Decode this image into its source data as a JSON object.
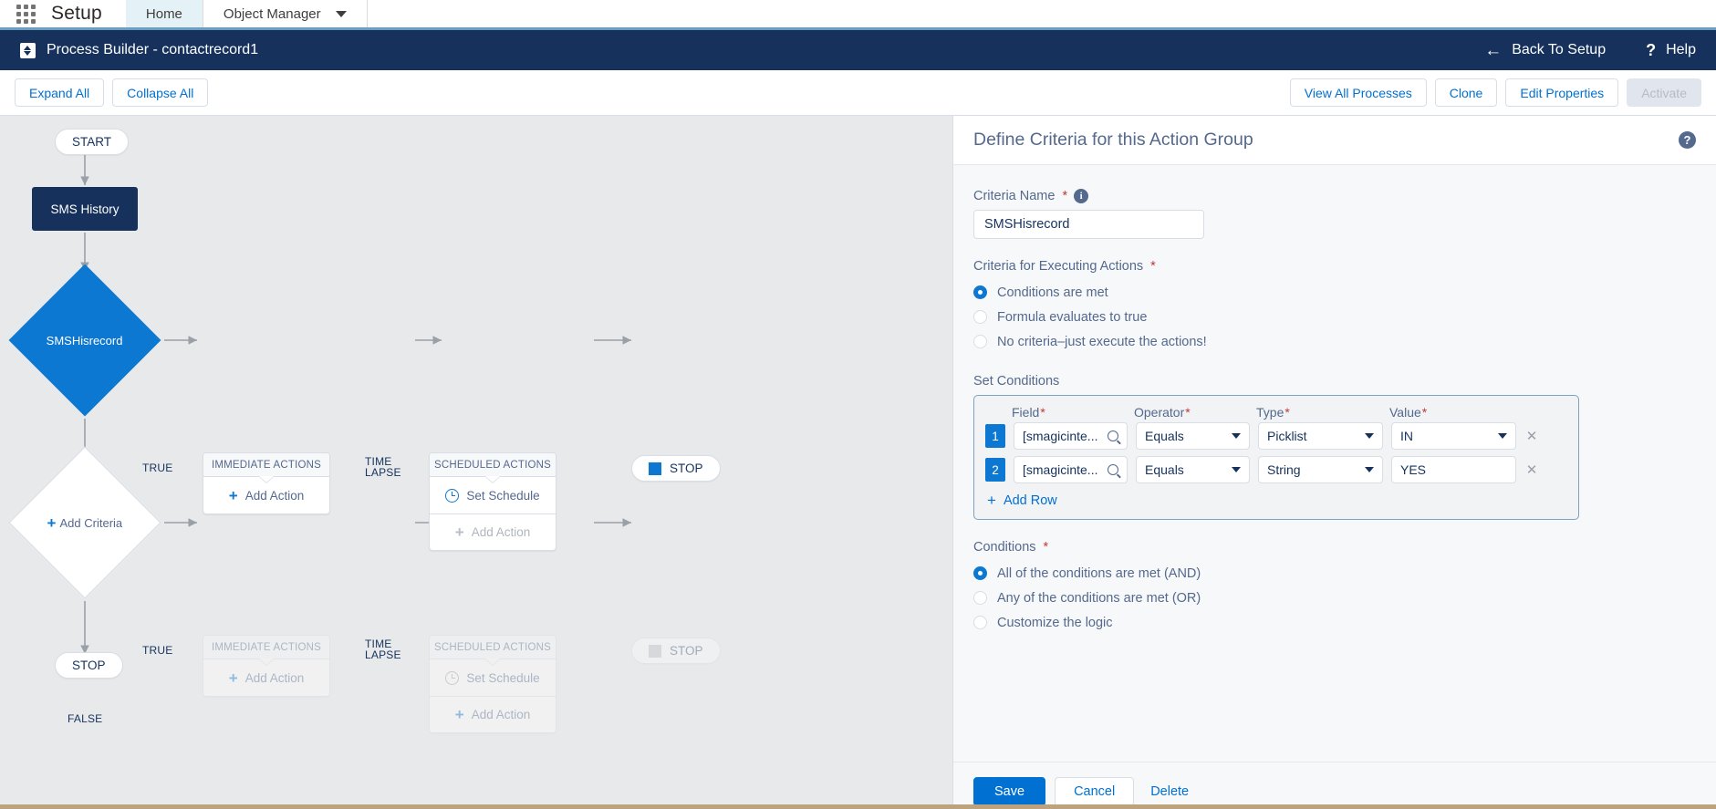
{
  "global_header": {
    "app_label": "Setup",
    "waffle_icon": "app-launcher-waffle-icon",
    "tabs": [
      {
        "label": "Home",
        "active": true,
        "has_chevron": false
      },
      {
        "label": "Object Manager",
        "active": false,
        "has_chevron": true
      }
    ]
  },
  "process_bar": {
    "icon": "process-builder-icon",
    "title": "Process Builder - contactrecord1",
    "back_label": "Back To Setup",
    "back_icon": "arrow-left-icon",
    "help_label": "Help",
    "help_icon": "question-mark-icon",
    "background": "#16325c"
  },
  "toolbar": {
    "expand_all": "Expand All",
    "collapse_all": "Collapse All",
    "view_all_processes": "View All Processes",
    "clone": "Clone",
    "edit_properties": "Edit Properties",
    "activate": "Activate",
    "activate_disabled": true
  },
  "canvas": {
    "start_label": "START",
    "object_node_label": "SMS History",
    "stop_label": "STOP",
    "criteria_1": {
      "label": "SMSHisrecord",
      "true_label": "TRUE",
      "false_label": "FALSE",
      "selected": true
    },
    "criteria_2": {
      "label": "Add Criteria",
      "plus_icon": "plus-icon",
      "true_label": "TRUE",
      "false_label": "FALSE",
      "selected": false
    },
    "immediate_actions_title": "IMMEDIATE ACTIONS",
    "scheduled_actions_title": "SCHEDULED ACTIONS",
    "time_lapse_line1": "TIME",
    "time_lapse_line2": "LAPSE",
    "add_action_label": "Add Action",
    "set_schedule_label": "Set Schedule",
    "set_schedule_icon": "clock-icon",
    "bottom_stop_label": "STOP",
    "diamond_color": "#0d78d1",
    "object_color": "#16325c",
    "background": "#e8e9ea"
  },
  "panel": {
    "title": "Define Criteria for this Action Group",
    "help_icon": "help-circle-icon",
    "criteria_name_label": "Criteria Name",
    "criteria_name_info_icon": "info-icon",
    "criteria_name_value": "SMSHisrecord",
    "criteria_name_placeholder": "",
    "exec_label": "Criteria for Executing Actions",
    "exec_options": [
      {
        "label": "Conditions are met",
        "selected": true
      },
      {
        "label": "Formula evaluates to true",
        "selected": false
      },
      {
        "label": "No criteria–just execute the actions!",
        "selected": false
      }
    ],
    "set_conditions_label": "Set Conditions",
    "columns": {
      "field": "Field",
      "operator": "Operator",
      "type": "Type",
      "value": "Value"
    },
    "rows": [
      {
        "num": "1",
        "field": "[smagicinte...",
        "field_icon": "search-icon",
        "operator": "Equals",
        "type": "Picklist",
        "value": "IN",
        "value_is_dropdown": true,
        "delete_icon": "close-icon"
      },
      {
        "num": "2",
        "field": "[smagicinte...",
        "field_icon": "search-icon",
        "operator": "Equals",
        "type": "String",
        "value": "YES",
        "value_is_dropdown": false,
        "delete_icon": "close-icon"
      }
    ],
    "add_row_label": "Add Row",
    "add_row_icon": "plus-icon",
    "conditions_label": "Conditions",
    "conditions_options": [
      {
        "label": "All of the conditions are met (AND)",
        "selected": true
      },
      {
        "label": "Any of the conditions are met (OR)",
        "selected": false
      },
      {
        "label": "Customize the logic",
        "selected": false
      }
    ],
    "save_label": "Save",
    "cancel_label": "Cancel",
    "delete_label": "Delete",
    "accent_color": "#0070d2"
  }
}
